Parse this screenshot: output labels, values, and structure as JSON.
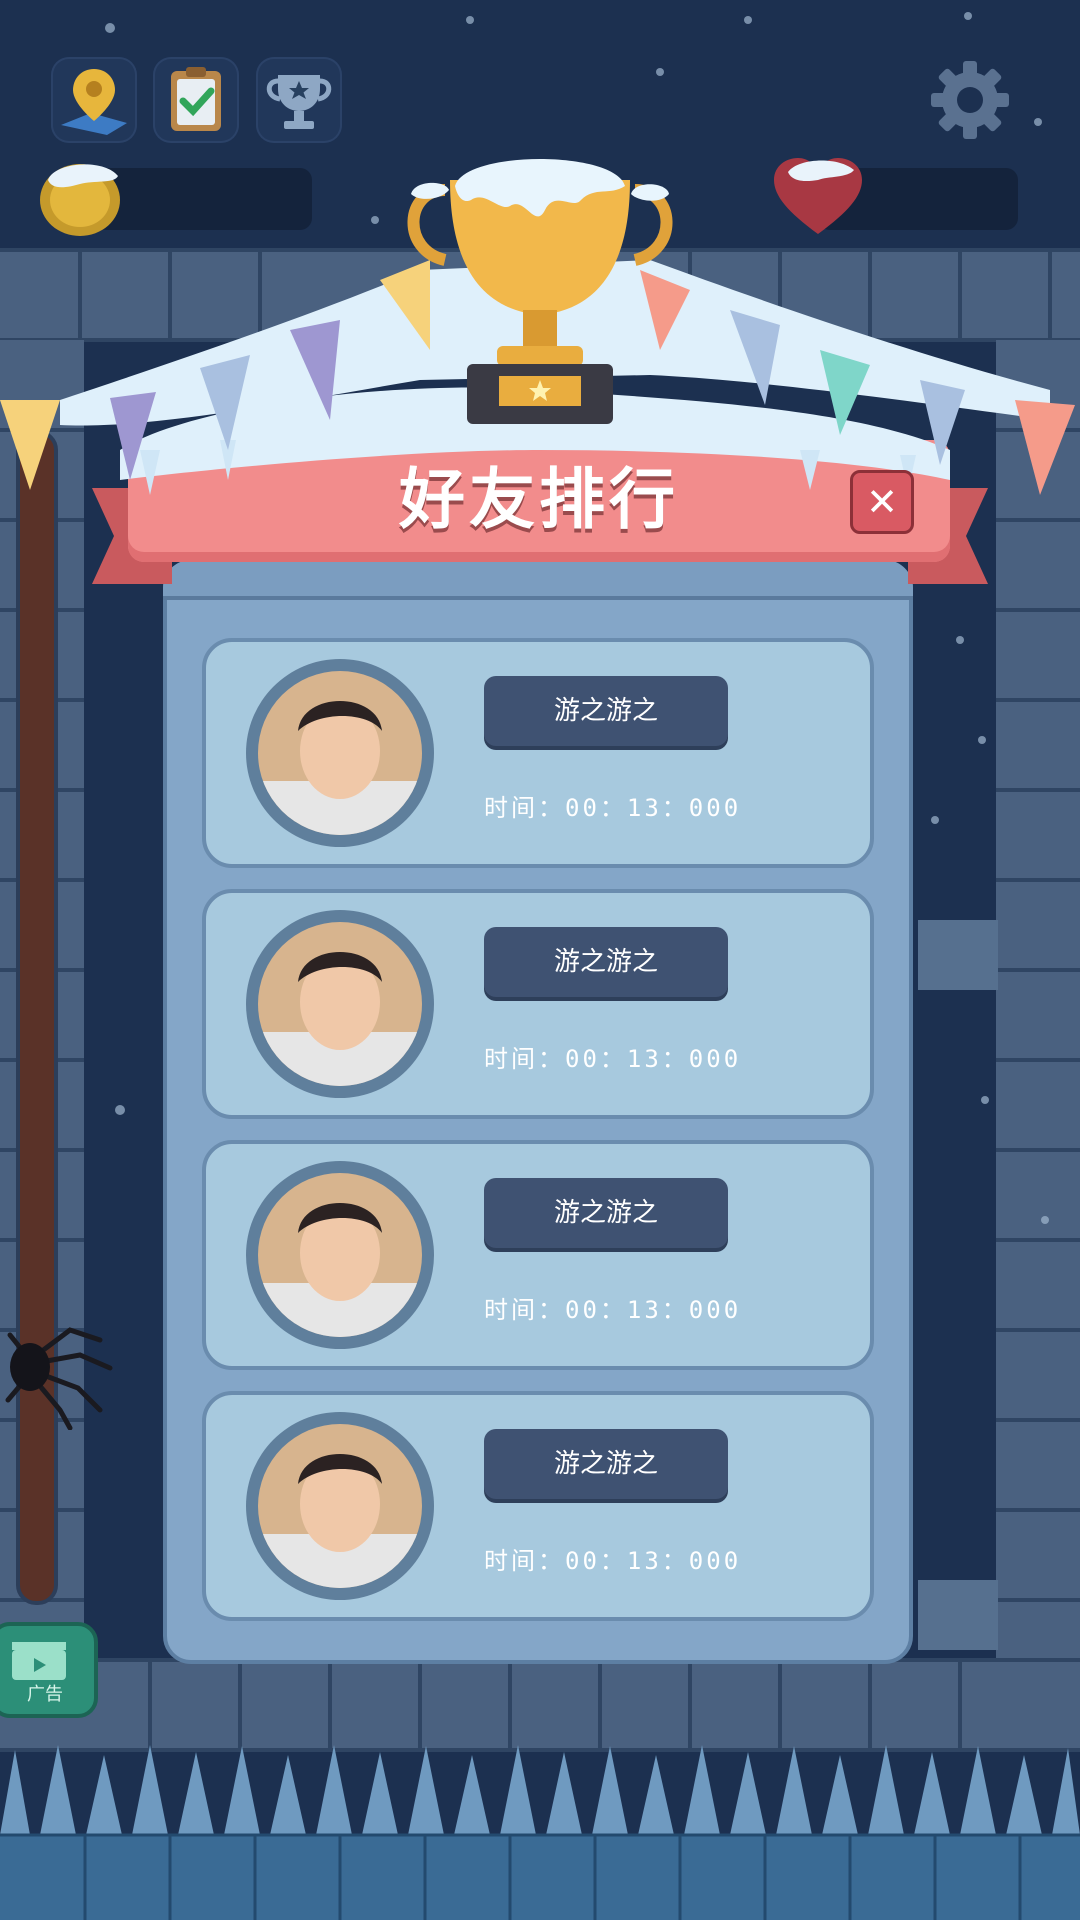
{
  "hud": {
    "icons": [
      "map-pin-icon",
      "clipboard-check-icon",
      "trophy-star-icon"
    ],
    "settings_icon": "gear-icon",
    "left_resource_icon": "snow-coin-icon",
    "right_resource_icon": "snow-heart-icon"
  },
  "panel": {
    "title": "好友排行",
    "close_label": "✕"
  },
  "leaderboard": [
    {
      "name": "游之游之",
      "time": "时间：00：13：000"
    },
    {
      "name": "游之游之",
      "time": "时间：00：13：000"
    },
    {
      "name": "游之游之",
      "time": "时间：00：13：000"
    },
    {
      "name": "游之游之",
      "time": "时间：00：13：000"
    }
  ],
  "ad_button": {
    "label": "广告"
  },
  "colors": {
    "background": "#1b2f4d",
    "ribbon": "#f28c8c",
    "panel": "#84a6c8",
    "card": "#a7c9de",
    "name_pill": "#3f5272"
  }
}
